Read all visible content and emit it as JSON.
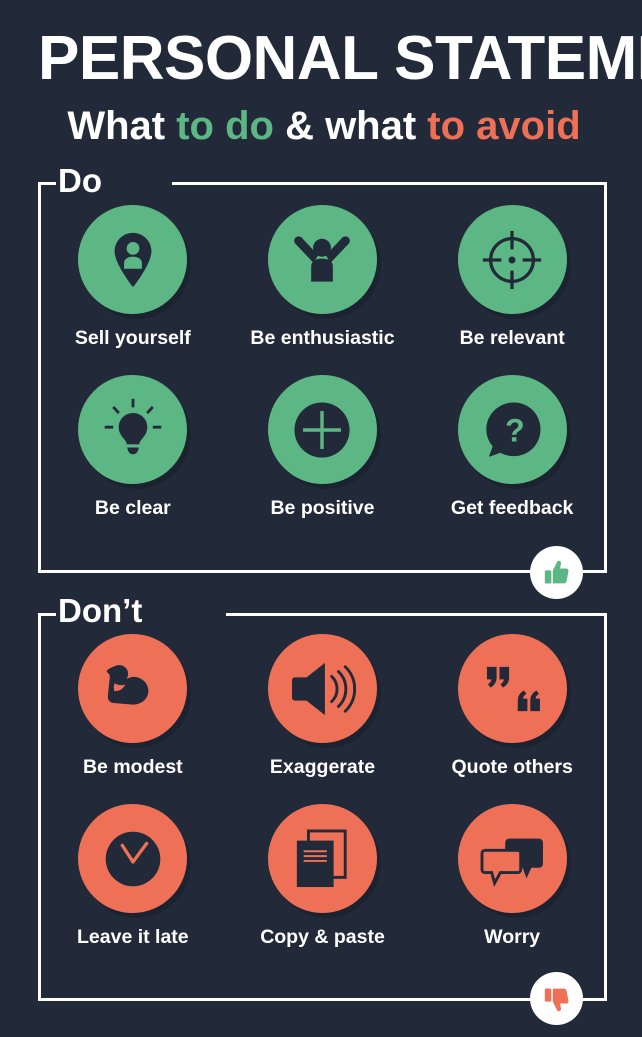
{
  "title": {
    "main": "PERSONAL STATEMENT",
    "sub_part1": "What ",
    "sub_part2": "to do",
    "sub_part3": " & what ",
    "sub_part4": "to avoid"
  },
  "colors": {
    "background": "#222a3a",
    "green": "#5cb784",
    "red": "#ee7157",
    "white": "#ffffff"
  },
  "sections": [
    {
      "heading": "Do",
      "accent": "#5cb784",
      "corner_badge_icon": "thumbs-up-icon",
      "items": [
        {
          "label": "Sell yourself",
          "icon": "location-pin-person-icon"
        },
        {
          "label": "Be enthusiastic",
          "icon": "person-arms-raised-icon"
        },
        {
          "label": "Be relevant",
          "icon": "crosshair-target-icon"
        },
        {
          "label": "Be clear",
          "icon": "lightbulb-icon"
        },
        {
          "label": "Be positive",
          "icon": "plus-circle-icon"
        },
        {
          "label": "Get feedback",
          "icon": "question-speech-bubble-icon"
        }
      ]
    },
    {
      "heading": "Don’t",
      "accent": "#ee7157",
      "corner_badge_icon": "thumbs-down-icon",
      "items": [
        {
          "label": "Be modest",
          "icon": "flexed-bicep-icon"
        },
        {
          "label": "Exaggerate",
          "icon": "loudspeaker-icon"
        },
        {
          "label": "Quote others",
          "icon": "quotation-marks-icon"
        },
        {
          "label": "Leave it late",
          "icon": "clock-icon"
        },
        {
          "label": "Copy & paste",
          "icon": "documents-copy-icon"
        },
        {
          "label": "Worry",
          "icon": "speech-bubbles-icon"
        }
      ]
    }
  ]
}
